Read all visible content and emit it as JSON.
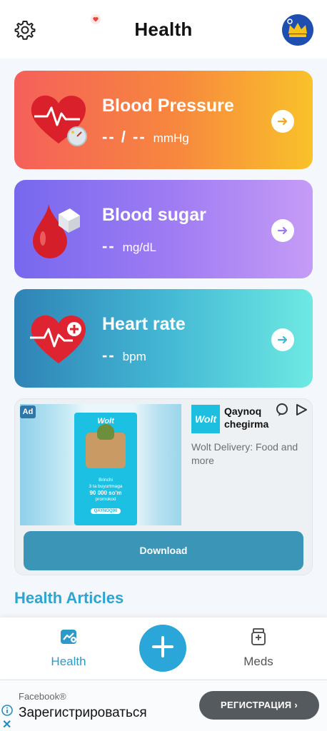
{
  "header": {
    "title": "Health"
  },
  "cards": [
    {
      "title": "Blood Pressure",
      "value": "-- / --",
      "unit": "mmHg",
      "arrow_color": "#f5a623"
    },
    {
      "title": "Blood sugar",
      "value": "--",
      "unit": "mg/dL",
      "arrow_color": "#9b7af3"
    },
    {
      "title": "Heart rate",
      "value": "--",
      "unit": "bpm",
      "arrow_color": "#43b7d4"
    }
  ],
  "ad": {
    "badge": "Ad",
    "logo_text": "Wolt",
    "title": "Qaynoq chegirma",
    "description": "Wolt Delivery: Food and more",
    "download_label": "Download",
    "promo": {
      "brand": "Wolt",
      "line1": "Brinchi",
      "line2": "3 ta buyurtmaga",
      "amount": "90 000 so'm",
      "line3": "promokod",
      "code": "QAYNOQ90"
    }
  },
  "section": {
    "title": "Health Articles"
  },
  "nav": {
    "health_label": "Health",
    "meds_label": "Meds"
  },
  "banner": {
    "source": "Facebook®",
    "text": "Зарегистрироваться",
    "button": "РЕГИСТРАЦИЯ ›"
  },
  "colors": {
    "accent": "#2aa7d8",
    "section_title": "#2da4d1"
  },
  "icons": [
    "gear-icon",
    "heart-icon",
    "crown-icon",
    "arrow-right-icon",
    "plus-icon",
    "health-chart-icon",
    "meds-icon",
    "info-icon",
    "close-icon",
    "adchoices-icon",
    "play-icon"
  ]
}
